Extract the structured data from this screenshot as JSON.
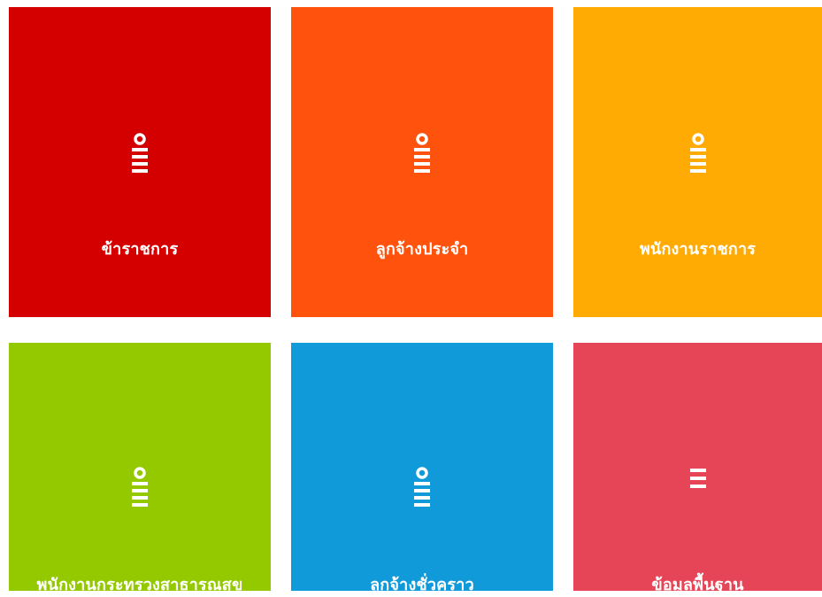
{
  "tiles": [
    {
      "label": "ข้าราชการ",
      "icon": "user-list-icon",
      "color": "#d40000"
    },
    {
      "label": "ลูกจ้างประจำ",
      "icon": "user-list-icon",
      "color": "#ff520c"
    },
    {
      "label": "พนักงานราชการ",
      "icon": "user-list-icon",
      "color": "#ffab03"
    },
    {
      "label": "พนักงานกระทรวงสาธารณสุข",
      "icon": "user-list-icon",
      "color": "#94c900"
    },
    {
      "label": "ลูกจ้างชั่วคราว",
      "icon": "user-list-icon",
      "color": "#119ad9"
    },
    {
      "label": "ข้อมูลพื้นฐาน",
      "icon": "menu-icon",
      "color": "#e64558"
    }
  ]
}
